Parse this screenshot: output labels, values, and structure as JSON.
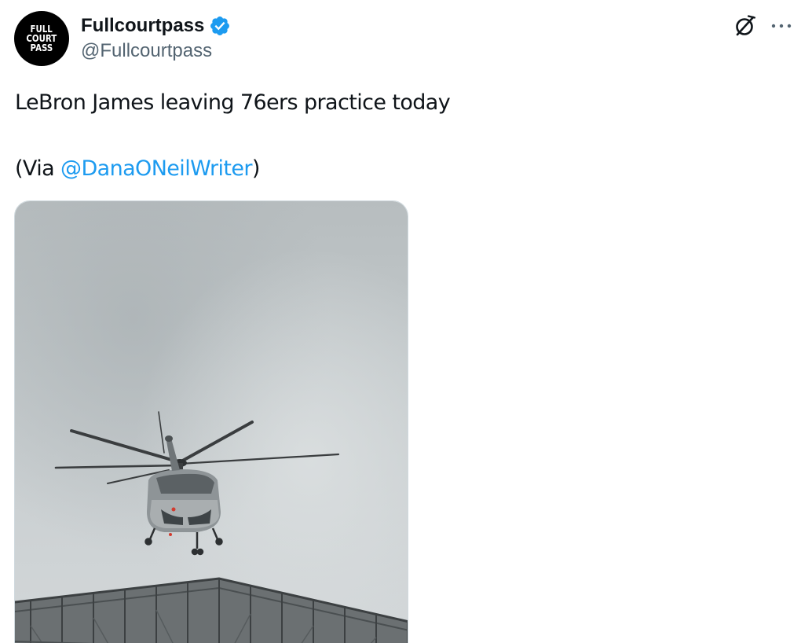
{
  "author": {
    "display_name": "Fullcourtpass",
    "handle": "@Fullcourtpass",
    "avatar_lines": [
      "FULL",
      "COURT",
      "PASS"
    ],
    "verified_icon": "verified-badge-icon",
    "verified_color": "#1d9bf0"
  },
  "actions": {
    "grok_icon": "grok-icon",
    "more_icon": "more-icon"
  },
  "tweet": {
    "text_line1": "LeBron James leaving 76ers practice today",
    "via_prefix": "(Via ",
    "mention": "@DanaONeilWriter",
    "via_suffix": ")",
    "mention_color": "#1d9bf0"
  },
  "media": {
    "type": "image",
    "subject_icon": "helicopter-photo"
  }
}
